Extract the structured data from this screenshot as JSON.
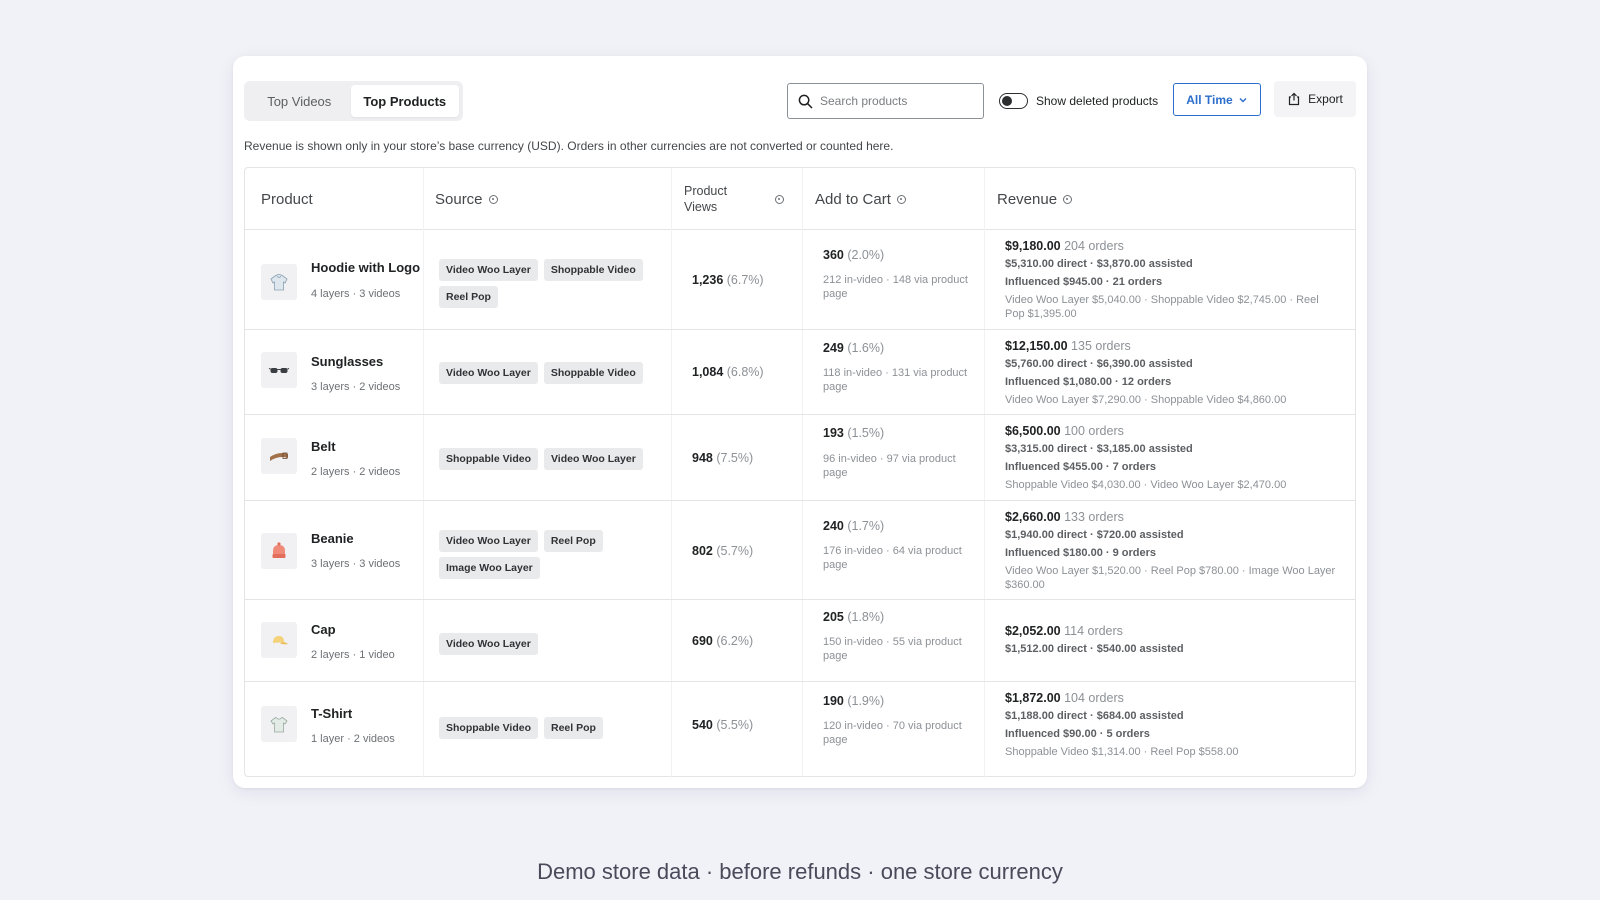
{
  "tabs": [
    {
      "label": "Top Videos"
    },
    {
      "label": "Top Products"
    }
  ],
  "search": {
    "placeholder": "Search products",
    "value": ""
  },
  "toggle": {
    "label": "Show deleted products",
    "on": false
  },
  "range": {
    "label": "All Time"
  },
  "export": {
    "label": "Export"
  },
  "note": "Revenue is shown only in your store’s base currency (USD). Orders in other currencies are not converted or counted here.",
  "columns": {
    "product": "Product",
    "source": "Source",
    "views_1": "Product",
    "views_2": "Views",
    "add_to_cart": "Add to Cart",
    "revenue": "Revenue"
  },
  "rows": [
    {
      "name": "Hoodie with Logo",
      "meta": "4 layers · 3 videos",
      "icon": "hoodie-icon",
      "sources": [
        "Video Woo Layer",
        "Shoppable Video",
        "Reel Pop"
      ],
      "views": "1,236",
      "views_pct": "(6.7%)",
      "atc": "360",
      "atc_pct": "(2.0%)",
      "atc_sub": "212 in-video · 148 via product page",
      "rev_total": "$9,180.00",
      "rev_orders": "204 orders",
      "rev_split": "$5,310.00 direct · $3,870.00 assisted",
      "rev_influenced": "Influenced $945.00 · 21 orders",
      "rev_breakdown": "Video Woo Layer $5,040.00 · Shoppable Video $2,745.00 · Reel Pop $1,395.00"
    },
    {
      "name": "Sunglasses",
      "meta": "3 layers · 2 videos",
      "icon": "sunglasses-icon",
      "sources": [
        "Video Woo Layer",
        "Shoppable Video"
      ],
      "views": "1,084",
      "views_pct": "(6.8%)",
      "atc": "249",
      "atc_pct": "(1.6%)",
      "atc_sub": "118 in-video · 131 via product page",
      "rev_total": "$12,150.00",
      "rev_orders": "135 orders",
      "rev_split": "$5,760.00 direct · $6,390.00 assisted",
      "rev_influenced": "Influenced $1,080.00 · 12 orders",
      "rev_breakdown": "Video Woo Layer $7,290.00 · Shoppable Video $4,860.00"
    },
    {
      "name": "Belt",
      "meta": "2 layers · 2 videos",
      "icon": "belt-icon",
      "sources": [
        "Shoppable Video",
        "Video Woo Layer"
      ],
      "views": "948",
      "views_pct": "(7.5%)",
      "atc": "193",
      "atc_pct": "(1.5%)",
      "atc_sub": "96 in-video · 97 via product page",
      "rev_total": "$6,500.00",
      "rev_orders": "100 orders",
      "rev_split": "$3,315.00 direct · $3,185.00 assisted",
      "rev_influenced": "Influenced $455.00 · 7 orders",
      "rev_breakdown": "Shoppable Video $4,030.00 · Video Woo Layer $2,470.00"
    },
    {
      "name": "Beanie",
      "meta": "3 layers · 3 videos",
      "icon": "beanie-icon",
      "sources": [
        "Video Woo Layer",
        "Reel Pop",
        "Image Woo Layer"
      ],
      "views": "802",
      "views_pct": "(5.7%)",
      "atc": "240",
      "atc_pct": "(1.7%)",
      "atc_sub": "176 in-video · 64 via product page",
      "rev_total": "$2,660.00",
      "rev_orders": "133 orders",
      "rev_split": "$1,940.00 direct · $720.00 assisted",
      "rev_influenced": "Influenced $180.00 · 9 orders",
      "rev_breakdown": "Video Woo Layer $1,520.00 · Reel Pop $780.00 · Image Woo Layer $360.00"
    },
    {
      "name": "Cap",
      "meta": "2 layers · 1 video",
      "icon": "cap-icon",
      "sources": [
        "Video Woo Layer"
      ],
      "views": "690",
      "views_pct": "(6.2%)",
      "atc": "205",
      "atc_pct": "(1.8%)",
      "atc_sub": "150 in-video · 55 via product page",
      "rev_total": "$2,052.00",
      "rev_orders": "114 orders",
      "rev_split": "$1,512.00 direct · $540.00 assisted",
      "rev_influenced": "",
      "rev_breakdown": ""
    },
    {
      "name": "T-Shirt",
      "meta": "1 layer · 2 videos",
      "icon": "tshirt-icon",
      "sources": [
        "Shoppable Video",
        "Reel Pop"
      ],
      "views": "540",
      "views_pct": "(5.5%)",
      "atc": "190",
      "atc_pct": "(1.9%)",
      "atc_sub": "120 in-video · 70 via product page",
      "rev_total": "$1,872.00",
      "rev_orders": "104 orders",
      "rev_split": "$1,188.00 direct · $684.00 assisted",
      "rev_influenced": "Influenced $90.00 · 5 orders",
      "rev_breakdown": "Shoppable Video $1,314.00 · Reel Pop $558.00"
    }
  ],
  "footer": "Demo store data · before refunds · one store currency",
  "colors": {
    "accent": "#2c6ecb",
    "page_bg": "#f1f1f8"
  }
}
